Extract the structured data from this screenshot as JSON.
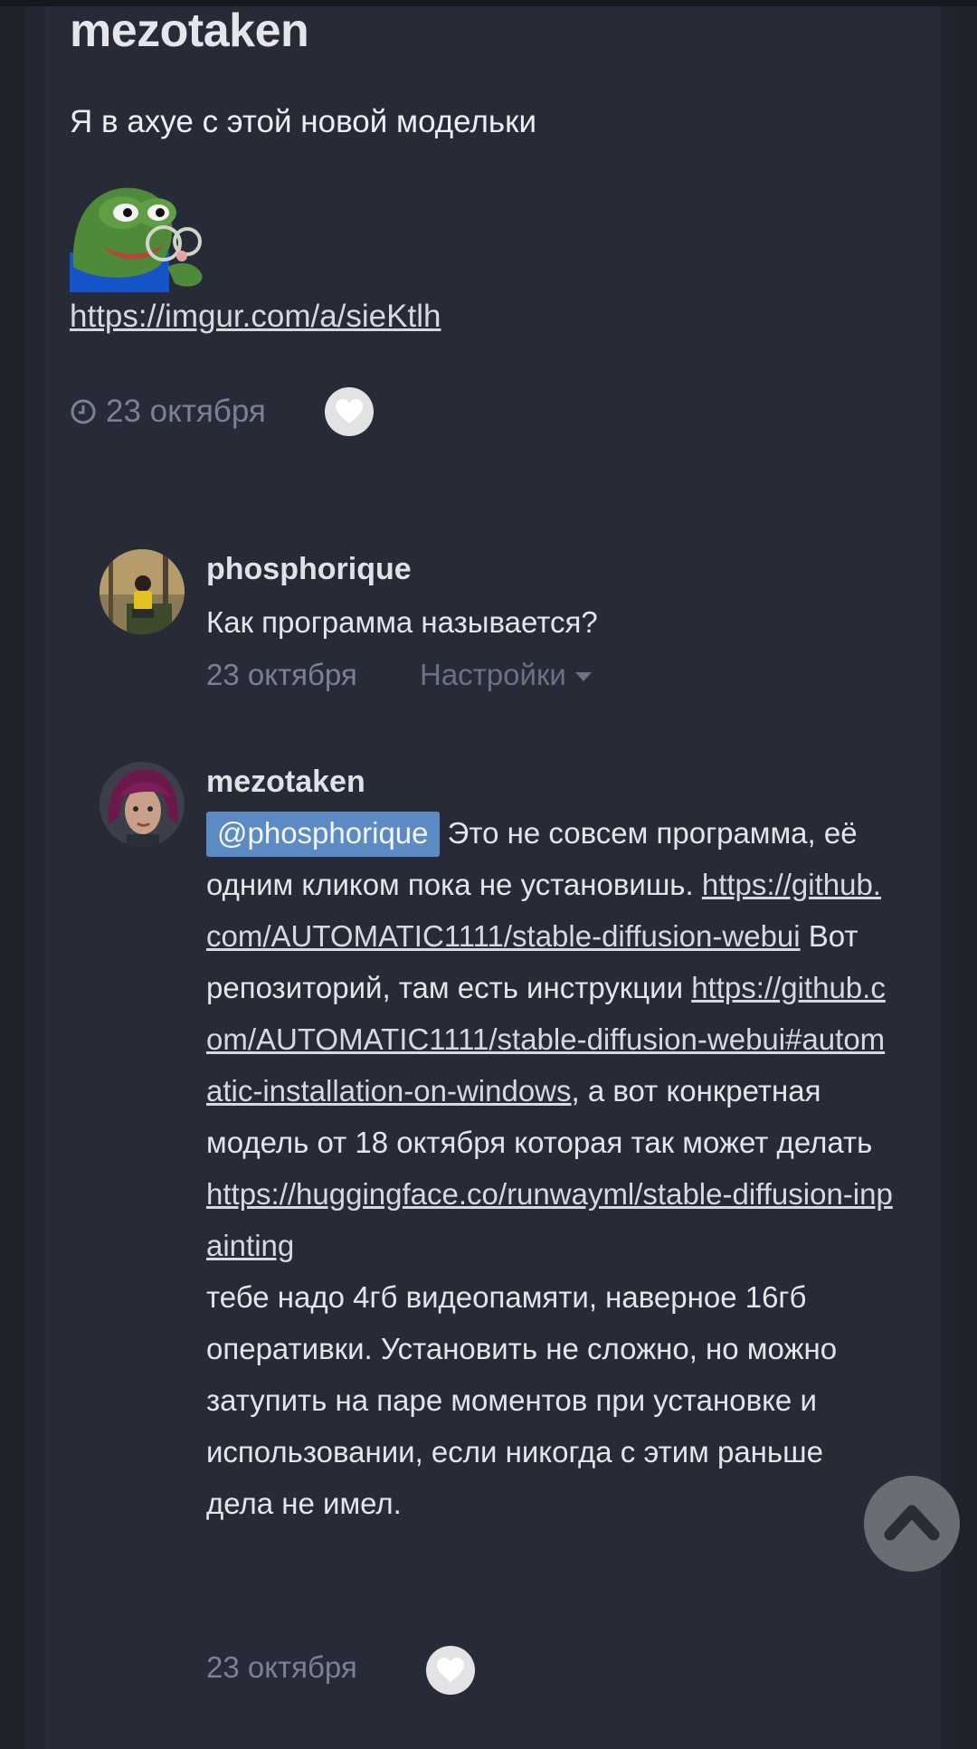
{
  "post": {
    "author": "mezotaken",
    "text": "Я в ахуе с этой новой модельки",
    "link": "https://imgur.com/a/sieKtlh",
    "date": "23 октября"
  },
  "comments": [
    {
      "author": "phosphorique",
      "text": "Как программа называется?",
      "date": "23 октября",
      "settings_label": "Настройки"
    },
    {
      "author": "mezotaken",
      "mention": "@phosphorique",
      "text_1": " Это не совсем программа, её одним кликом пока не установишь. ",
      "link_1": "https://github.com/AUTOMATIC1111/stable-diffusion-webui",
      "text_2": " Вот репозиторий, там есть инструкции ",
      "link_2": "https://github.com/AUTOMATIC1111/stable-diffusion-webui#automatic-installation-on-windows",
      "text_3": ", а вот конкретная модель от 18 октября которая так может делать ",
      "link_3": "https://huggingface.co/runwayml/stable-diffusion-inpainting",
      "text_4": "тебе надо 4гб видеопамяти, наверное 16гб оперативки. Установить не сложно, но можно затупить на паре моментов при установке и использовании, если никогда с этим раньше дела не имел.",
      "date": "23 октября"
    }
  ],
  "icons": {
    "clock": "clock-icon",
    "like": "heart-icon",
    "scroll_top": "chevron-up-icon"
  },
  "colors": {
    "background": "#272b37",
    "mention": "#5c8bc4",
    "like_button": "#e3e3e6"
  }
}
